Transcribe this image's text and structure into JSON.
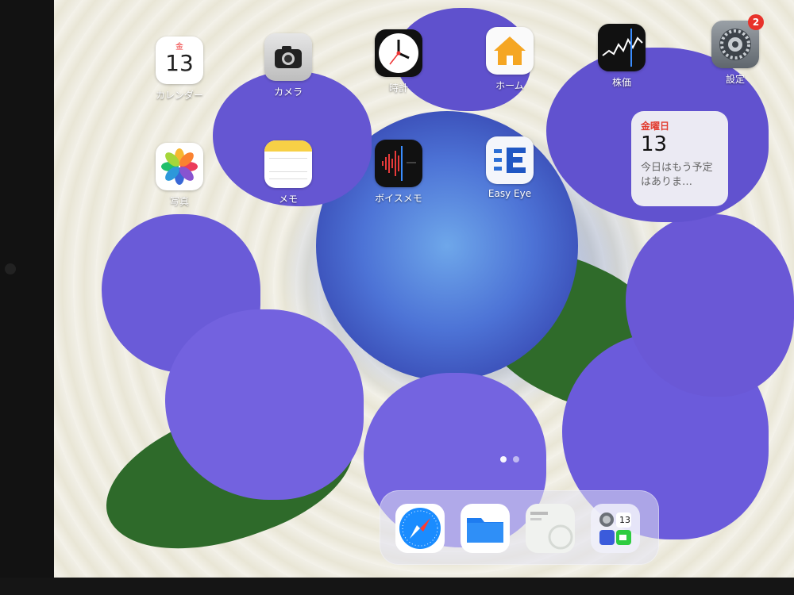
{
  "home": {
    "apps": [
      {
        "id": "calendar",
        "label": "カレンダー",
        "weekday": "金",
        "day": "13"
      },
      {
        "id": "camera",
        "label": "カメラ"
      },
      {
        "id": "clock",
        "label": "時計"
      },
      {
        "id": "home",
        "label": "ホーム"
      },
      {
        "id": "stocks",
        "label": "株価"
      },
      {
        "id": "settings",
        "label": "設定",
        "badge": "2"
      },
      {
        "id": "photos",
        "label": "写真"
      },
      {
        "id": "notes",
        "label": "メモ"
      },
      {
        "id": "voice-memos",
        "label": "ボイスメモ"
      },
      {
        "id": "easy-eye",
        "label": "Easy Eye"
      }
    ],
    "widget": {
      "weekday": "金曜日",
      "day": "13",
      "text": "今日はもう予定はありま…"
    },
    "page_dots": 2,
    "dock": {
      "apps": [
        "safari",
        "files",
        "recent-app",
        "app-library-folder"
      ],
      "folder_day": "13"
    }
  },
  "colors": {
    "badge": "#e8322a",
    "hydrangea": "#6b5ad6",
    "leaf": "#2f6b2a"
  }
}
